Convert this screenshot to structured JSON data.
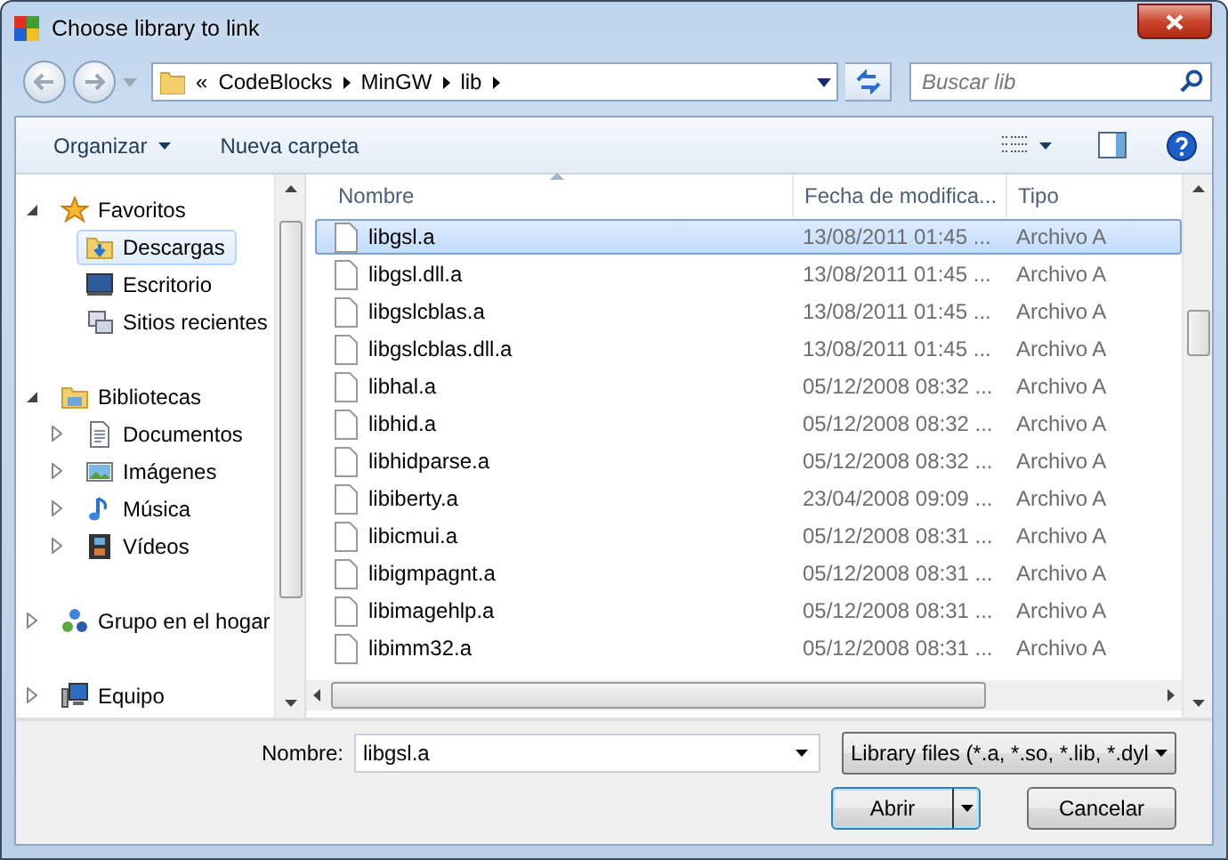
{
  "window": {
    "title": "Choose library to link"
  },
  "address_bar": {
    "overflow": "«",
    "path": [
      "CodeBlocks",
      "MinGW",
      "lib"
    ]
  },
  "search": {
    "placeholder": "Buscar lib"
  },
  "toolbar": {
    "organize": "Organizar",
    "new_folder": "Nueva carpeta"
  },
  "nav_pane": [
    {
      "label": "Favoritos",
      "expanded": true,
      "children": [
        {
          "label": "Descargas",
          "selected": true
        },
        {
          "label": "Escritorio",
          "selected": false
        },
        {
          "label": "Sitios recientes",
          "selected": false
        }
      ]
    },
    {
      "label": "Bibliotecas",
      "expanded": true,
      "children": [
        {
          "label": "Documentos",
          "expanded": false,
          "selected": false
        },
        {
          "label": "Imágenes",
          "expanded": false,
          "selected": false
        },
        {
          "label": "Música",
          "expanded": false,
          "selected": false
        },
        {
          "label": "Vídeos",
          "expanded": false,
          "selected": false
        }
      ]
    },
    {
      "label": "Grupo en el hogar",
      "expanded": false
    },
    {
      "label": "Equipo",
      "expanded": false
    }
  ],
  "file_list": {
    "columns": [
      {
        "label": "Nombre",
        "sorted": true
      },
      {
        "label": "Fecha de modifica...",
        "sorted": false
      },
      {
        "label": "Tipo",
        "sorted": false
      }
    ],
    "rows": [
      {
        "name": "libgsl.a",
        "date": "13/08/2011 01:45 ...",
        "type": "Archivo A",
        "selected": true
      },
      {
        "name": "libgsl.dll.a",
        "date": "13/08/2011 01:45 ...",
        "type": "Archivo A",
        "selected": false
      },
      {
        "name": "libgslcblas.a",
        "date": "13/08/2011 01:45 ...",
        "type": "Archivo A",
        "selected": false
      },
      {
        "name": "libgslcblas.dll.a",
        "date": "13/08/2011 01:45 ...",
        "type": "Archivo A",
        "selected": false
      },
      {
        "name": "libhal.a",
        "date": "05/12/2008 08:32 ...",
        "type": "Archivo A",
        "selected": false
      },
      {
        "name": "libhid.a",
        "date": "05/12/2008 08:32 ...",
        "type": "Archivo A",
        "selected": false
      },
      {
        "name": "libhidparse.a",
        "date": "05/12/2008 08:32 ...",
        "type": "Archivo A",
        "selected": false
      },
      {
        "name": "libiberty.a",
        "date": "23/04/2008 09:09 ...",
        "type": "Archivo A",
        "selected": false
      },
      {
        "name": "libicmui.a",
        "date": "05/12/2008 08:31 ...",
        "type": "Archivo A",
        "selected": false
      },
      {
        "name": "libigmpagnt.a",
        "date": "05/12/2008 08:31 ...",
        "type": "Archivo A",
        "selected": false
      },
      {
        "name": "libimagehlp.a",
        "date": "05/12/2008 08:31 ...",
        "type": "Archivo A",
        "selected": false
      },
      {
        "name": "libimm32.a",
        "date": "05/12/2008 08:31 ...",
        "type": "Archivo A",
        "selected": false
      }
    ]
  },
  "file_name": {
    "label": "Nombre:",
    "value": "libgsl.a"
  },
  "file_type": {
    "value": "Library files (*.a, *.so, *.lib, *.dyl"
  },
  "buttons": {
    "open": "Abrir",
    "cancel": "Cancelar"
  }
}
